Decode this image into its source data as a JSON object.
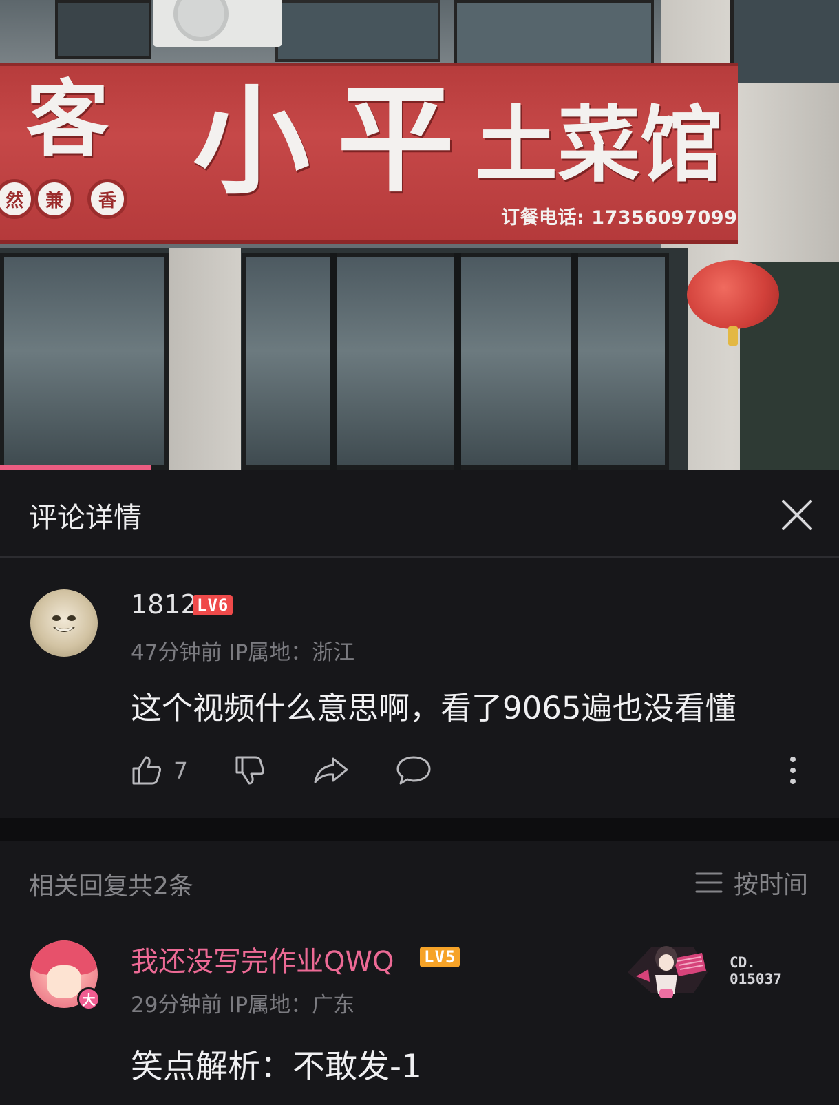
{
  "video": {
    "sign_chars": [
      "客",
      "小",
      "平",
      "土",
      "菜",
      "馆"
    ],
    "sign_badges": [
      "然",
      "兼",
      "香"
    ],
    "sign_phone": "订餐电话: 17356097099",
    "progress_fraction": 0.18
  },
  "panel": {
    "title": "评论详情",
    "close_icon": "close-icon"
  },
  "main_comment": {
    "username": "1812-",
    "level": "LV6",
    "meta": "47分钟前 IP属地：浙江",
    "text": "这个视频什么意思啊，看了9065遍也没看懂",
    "like_count": "7",
    "icons": [
      "thumbs-up-icon",
      "thumbs-down-icon",
      "share-icon",
      "reply-icon",
      "more-icon"
    ]
  },
  "replies_bar": {
    "count_label": "相关回复共2条",
    "sort_label": "按时间",
    "sort_icon": "menu-lines-icon"
  },
  "reply": {
    "username": "我还没写完作业QWQ",
    "level": "LV5",
    "vip_badge": "大",
    "meta": "29分钟前 IP属地：广东",
    "text": "笑点解析：不敢发-1",
    "decoration_text": "CD.\n015037"
  },
  "colors": {
    "background": "#17171a",
    "accent_pink": "#ec6a95",
    "progress": "#ec5d82",
    "lv6": "#ef4a4a",
    "lv5": "#f6a328",
    "muted": "#7b7b80"
  }
}
